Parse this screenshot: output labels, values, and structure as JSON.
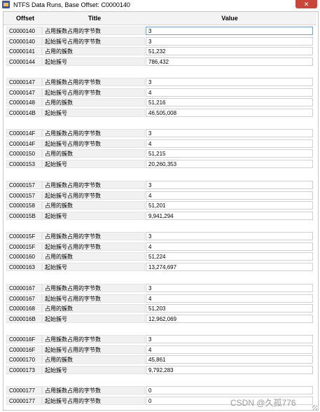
{
  "window": {
    "title": "NTFS Data Runs, Base Offset: C0000140",
    "close_glyph": "✕"
  },
  "columns": {
    "offset": "Offset",
    "title": "Title",
    "value": "Value"
  },
  "groups": [
    {
      "rows": [
        {
          "offset": "C0000140",
          "title": "占用簇数占用的字节数",
          "value": "3"
        },
        {
          "offset": "C0000140",
          "title": "起始簇号占用的字节数",
          "value": "3"
        },
        {
          "offset": "C0000141",
          "title": "占用的簇数",
          "value": "51,232"
        },
        {
          "offset": "C0000144",
          "title": "起始簇号",
          "value": "786,432"
        }
      ]
    },
    {
      "rows": [
        {
          "offset": "C0000147",
          "title": "占用簇数占用的字节数",
          "value": "3"
        },
        {
          "offset": "C0000147",
          "title": "起始簇号占用的字节数",
          "value": "4"
        },
        {
          "offset": "C0000148",
          "title": "占用的簇数",
          "value": "51,216"
        },
        {
          "offset": "C000014B",
          "title": "起始簇号",
          "value": "46,505,008"
        }
      ]
    },
    {
      "rows": [
        {
          "offset": "C000014F",
          "title": "占用簇数占用的字节数",
          "value": "3"
        },
        {
          "offset": "C000014F",
          "title": "起始簇号占用的字节数",
          "value": "4"
        },
        {
          "offset": "C0000150",
          "title": "占用的簇数",
          "value": "51,215"
        },
        {
          "offset": "C0000153",
          "title": "起始簇号",
          "value": "20,260,353"
        }
      ]
    },
    {
      "rows": [
        {
          "offset": "C0000157",
          "title": "占用簇数占用的字节数",
          "value": "3"
        },
        {
          "offset": "C0000157",
          "title": "起始簇号占用的字节数",
          "value": "4"
        },
        {
          "offset": "C0000158",
          "title": "占用的簇数",
          "value": "51,201"
        },
        {
          "offset": "C000015B",
          "title": "起始簇号",
          "value": "9,941,294"
        }
      ]
    },
    {
      "rows": [
        {
          "offset": "C000015F",
          "title": "占用簇数占用的字节数",
          "value": "3"
        },
        {
          "offset": "C000015F",
          "title": "起始簇号占用的字节数",
          "value": "4"
        },
        {
          "offset": "C0000160",
          "title": "占用的簇数",
          "value": "51,224"
        },
        {
          "offset": "C0000163",
          "title": "起始簇号",
          "value": "13,274,697"
        }
      ]
    },
    {
      "rows": [
        {
          "offset": "C0000167",
          "title": "占用簇数占用的字节数",
          "value": "3"
        },
        {
          "offset": "C0000167",
          "title": "起始簇号占用的字节数",
          "value": "4"
        },
        {
          "offset": "C0000168",
          "title": "占用的簇数",
          "value": "51,203"
        },
        {
          "offset": "C000016B",
          "title": "起始簇号",
          "value": "12,962,069"
        }
      ]
    },
    {
      "rows": [
        {
          "offset": "C000016F",
          "title": "占用簇数占用的字节数",
          "value": "3"
        },
        {
          "offset": "C000016F",
          "title": "起始簇号占用的字节数",
          "value": "4"
        },
        {
          "offset": "C0000170",
          "title": "占用的簇数",
          "value": "45,861"
        },
        {
          "offset": "C0000173",
          "title": "起始簇号",
          "value": "9,792,283"
        }
      ]
    },
    {
      "rows": [
        {
          "offset": "C0000177",
          "title": "占用簇数占用的字节数",
          "value": "0"
        },
        {
          "offset": "C0000177",
          "title": "起始簇号占用的字节数",
          "value": "0"
        }
      ]
    }
  ],
  "watermark": "CSDN @久孤776",
  "colors": {
    "close_button": "#c8453a",
    "title_icon": "#3a4fb8"
  }
}
